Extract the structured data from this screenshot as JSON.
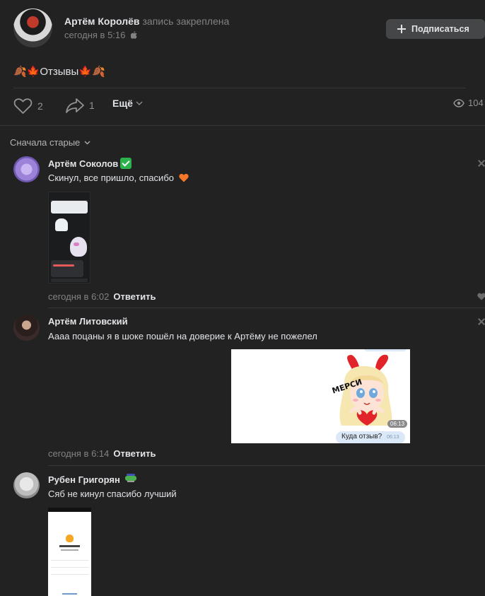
{
  "post": {
    "author": "Артём Королёв",
    "pinned_label": "запись закреплена",
    "time": "сегодня в 5:16",
    "subscribe_label": "Подписаться",
    "text": "🍂🍁Отзывы🍁🍂"
  },
  "actions": {
    "likes": "2",
    "shares": "1",
    "more_label": "Ещё",
    "views": "104"
  },
  "sort_label": "Сначала старые",
  "comments": [
    {
      "author": "Артём Соколов",
      "text": "Скинул, все пришло, спасибо",
      "time": "сегодня в 6:02",
      "reply_label": "Ответить"
    },
    {
      "author": "Артём Литовский",
      "text": "Аааа поцаны я в шоке пошёл на доверие к Артёму не пожелел",
      "time": "сегодня в 6:14",
      "reply_label": "Ответить",
      "sticker": {
        "caption": "МЕРСИ",
        "time_badge": "06:13",
        "bubble_text": "Куда отзыв?",
        "bubble_time": "06:13"
      }
    },
    {
      "author": "Рубен Григорян",
      "text": "Сяб не кинул спасибо лучший"
    }
  ],
  "colors": {
    "background": "#222222",
    "text": "#e1e3e6",
    "muted": "#828282",
    "button": "#454647"
  }
}
